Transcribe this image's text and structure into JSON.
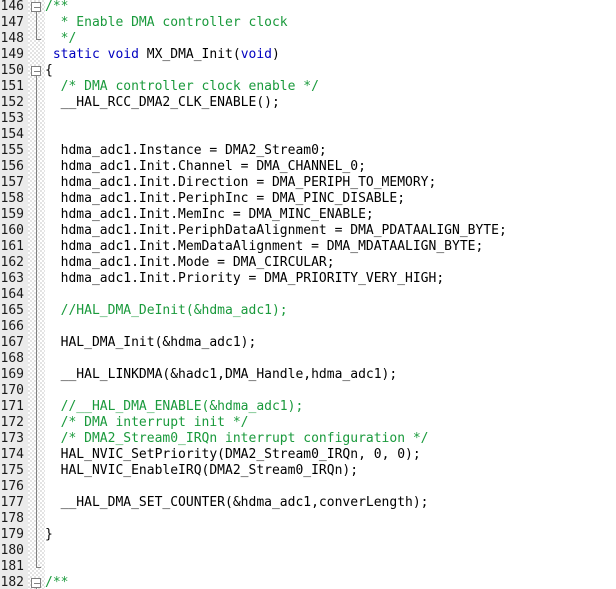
{
  "editor": {
    "title": "C source code editor",
    "language": "C",
    "font_size_px": 13,
    "line_height_px": 16,
    "colors": {
      "background": "#ffffff",
      "gutter_background": "#ebebeb",
      "line_number": "#1a1a1a",
      "fold_marker": "#808080",
      "text": "#000000",
      "keyword": "#0000c0",
      "comment": "#1a9a3c"
    },
    "first_visible_line": 146,
    "last_visible_line": 182,
    "lines": [
      {
        "number": "146",
        "fold": "box",
        "tokens": [
          {
            "t": "/**",
            "c": "comment"
          }
        ]
      },
      {
        "number": "147",
        "fold": "line",
        "tokens": [
          {
            "t": "  * Enable DMA controller clock",
            "c": "comment"
          }
        ]
      },
      {
        "number": "148",
        "fold": "end",
        "tokens": [
          {
            "t": "  */",
            "c": "comment"
          }
        ]
      },
      {
        "number": "149",
        "fold": "none",
        "tokens": [
          {
            "t": " ",
            "c": "plain"
          },
          {
            "t": "static",
            "c": "kw"
          },
          {
            "t": " ",
            "c": "plain"
          },
          {
            "t": "void",
            "c": "kw"
          },
          {
            "t": " MX_DMA_Init(",
            "c": "plain"
          },
          {
            "t": "void",
            "c": "kw"
          },
          {
            "t": ")",
            "c": "plain"
          }
        ]
      },
      {
        "number": "150",
        "fold": "box",
        "tokens": [
          {
            "t": "{",
            "c": "plain"
          }
        ]
      },
      {
        "number": "151",
        "fold": "line",
        "tokens": [
          {
            "t": "  /* DMA controller clock enable */",
            "c": "comment"
          }
        ]
      },
      {
        "number": "152",
        "fold": "line",
        "tokens": [
          {
            "t": "  __HAL_RCC_DMA2_CLK_ENABLE();",
            "c": "plain"
          }
        ]
      },
      {
        "number": "153",
        "fold": "line",
        "tokens": []
      },
      {
        "number": "154",
        "fold": "line",
        "tokens": []
      },
      {
        "number": "155",
        "fold": "line",
        "tokens": [
          {
            "t": "  hdma_adc1.Instance = DMA2_Stream0;",
            "c": "plain"
          }
        ]
      },
      {
        "number": "156",
        "fold": "line",
        "tokens": [
          {
            "t": "  hdma_adc1.Init.Channel = DMA_CHANNEL_0;",
            "c": "plain"
          }
        ]
      },
      {
        "number": "157",
        "fold": "line",
        "tokens": [
          {
            "t": "  hdma_adc1.Init.Direction = DMA_PERIPH_TO_MEMORY;",
            "c": "plain"
          }
        ]
      },
      {
        "number": "158",
        "fold": "line",
        "tokens": [
          {
            "t": "  hdma_adc1.Init.PeriphInc = DMA_PINC_DISABLE;",
            "c": "plain"
          }
        ]
      },
      {
        "number": "159",
        "fold": "line",
        "tokens": [
          {
            "t": "  hdma_adc1.Init.MemInc = DMA_MINC_ENABLE;",
            "c": "plain"
          }
        ]
      },
      {
        "number": "160",
        "fold": "line",
        "tokens": [
          {
            "t": "  hdma_adc1.Init.PeriphDataAlignment = DMA_PDATAALIGN_BYTE;",
            "c": "plain"
          }
        ]
      },
      {
        "number": "161",
        "fold": "line",
        "tokens": [
          {
            "t": "  hdma_adc1.Init.MemDataAlignment = DMA_MDATAALIGN_BYTE;",
            "c": "plain"
          }
        ]
      },
      {
        "number": "162",
        "fold": "line",
        "tokens": [
          {
            "t": "  hdma_adc1.Init.Mode = DMA_CIRCULAR;",
            "c": "plain"
          }
        ]
      },
      {
        "number": "163",
        "fold": "line",
        "tokens": [
          {
            "t": "  hdma_adc1.Init.Priority = DMA_PRIORITY_VERY_HIGH;",
            "c": "plain"
          }
        ]
      },
      {
        "number": "164",
        "fold": "line",
        "tokens": []
      },
      {
        "number": "165",
        "fold": "line",
        "tokens": [
          {
            "t": "  //HAL_DMA_DeInit(&hdma_adc1);",
            "c": "comment"
          }
        ]
      },
      {
        "number": "166",
        "fold": "line",
        "tokens": []
      },
      {
        "number": "167",
        "fold": "line",
        "tokens": [
          {
            "t": "  HAL_DMA_Init(&hdma_adc1);",
            "c": "plain"
          }
        ]
      },
      {
        "number": "168",
        "fold": "line",
        "tokens": []
      },
      {
        "number": "169",
        "fold": "line",
        "tokens": [
          {
            "t": "  __HAL_LINKDMA(&hadc1,DMA_Handle,hdma_adc1);",
            "c": "plain"
          }
        ]
      },
      {
        "number": "170",
        "fold": "line",
        "tokens": []
      },
      {
        "number": "171",
        "fold": "line",
        "tokens": [
          {
            "t": "  //__HAL_DMA_ENABLE(&hdma_adc1);",
            "c": "comment"
          }
        ]
      },
      {
        "number": "172",
        "fold": "line",
        "tokens": [
          {
            "t": "  /* DMA interrupt init */",
            "c": "comment"
          }
        ]
      },
      {
        "number": "173",
        "fold": "line",
        "tokens": [
          {
            "t": "  /* DMA2_Stream0_IRQn interrupt configuration */",
            "c": "comment"
          }
        ]
      },
      {
        "number": "174",
        "fold": "line",
        "tokens": [
          {
            "t": "  HAL_NVIC_SetPriority(DMA2_Stream0_IRQn, ",
            "c": "plain"
          },
          {
            "t": "0",
            "c": "num"
          },
          {
            "t": ", ",
            "c": "plain"
          },
          {
            "t": "0",
            "c": "num"
          },
          {
            "t": ");",
            "c": "plain"
          }
        ]
      },
      {
        "number": "175",
        "fold": "line",
        "tokens": [
          {
            "t": "  HAL_NVIC_EnableIRQ(DMA2_Stream0_IRQn);",
            "c": "plain"
          }
        ]
      },
      {
        "number": "176",
        "fold": "line",
        "tokens": []
      },
      {
        "number": "177",
        "fold": "line",
        "tokens": [
          {
            "t": "  __HAL_DMA_SET_COUNTER(&hdma_adc1,converLength);",
            "c": "plain"
          }
        ]
      },
      {
        "number": "178",
        "fold": "line",
        "tokens": []
      },
      {
        "number": "179",
        "fold": "line",
        "tokens": [
          {
            "t": "}",
            "c": "plain"
          }
        ]
      },
      {
        "number": "180",
        "fold": "line",
        "tokens": []
      },
      {
        "number": "181",
        "fold": "end",
        "tokens": []
      },
      {
        "number": "182",
        "fold": "box-half",
        "tokens": [
          {
            "t": "/**",
            "c": "comment"
          }
        ]
      }
    ]
  }
}
